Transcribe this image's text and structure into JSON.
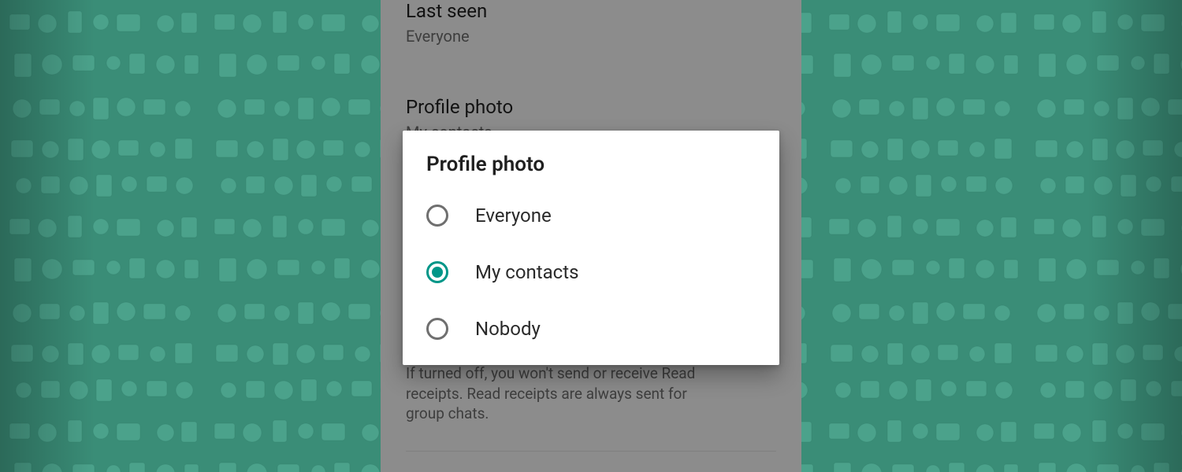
{
  "settings": {
    "last_seen": {
      "title": "Last seen",
      "value": "Everyone"
    },
    "profile_photo": {
      "title": "Profile photo",
      "value": "My contacts"
    },
    "read_receipts_desc": "If turned off, you won't send or receive Read receipts. Read receipts are always sent for group chats."
  },
  "dialog": {
    "title": "Profile photo",
    "options": [
      {
        "label": "Everyone",
        "selected": false
      },
      {
        "label": "My contacts",
        "selected": true
      },
      {
        "label": "Nobody",
        "selected": false
      }
    ]
  },
  "colors": {
    "accent": "#009688"
  }
}
